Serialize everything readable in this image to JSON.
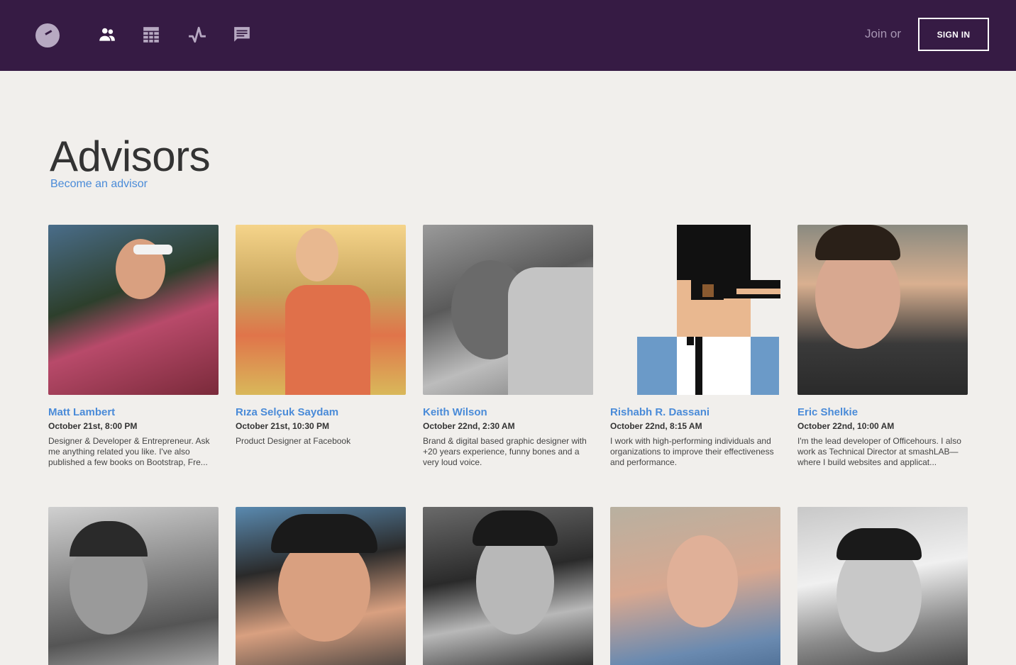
{
  "header": {
    "nav_icons": [
      "people-icon",
      "grid-icon",
      "activity-icon",
      "chat-icon"
    ],
    "join_text": "Join or",
    "signin_label": "SIGN IN",
    "colors": {
      "bar": "#361b44",
      "icon": "#b7a9c2"
    }
  },
  "page": {
    "title": "Advisors",
    "become_link": "Become an advisor",
    "link_color": "#4a8bd8"
  },
  "advisors": [
    {
      "name": "Matt Lambert",
      "date": "October 21st, 8:00 PM",
      "bio": "Designer & Developer & Entrepreneur. Ask me anything related you like. I've also published a few books on Bootstrap, Fre..."
    },
    {
      "name": "Rıza Selçuk Saydam",
      "date": "October 21st, 10:30 PM",
      "bio": "Product Designer at Facebook"
    },
    {
      "name": "Keith Wilson",
      "date": "October 22nd, 2:30 AM",
      "bio": "Brand & digital based graphic designer with +20 years experience, funny bones and a very loud voice."
    },
    {
      "name": "Rishabh R. Dassani",
      "date": "October 22nd, 8:15 AM",
      "bio": "I work with high-performing individuals and organizations to improve their effectiveness and performance."
    },
    {
      "name": "Eric Shelkie",
      "date": "October 22nd, 10:00 AM",
      "bio": "I'm the lead developer of Officehours. I also work as Technical Director at smashLAB—where I build websites and applicat..."
    }
  ]
}
